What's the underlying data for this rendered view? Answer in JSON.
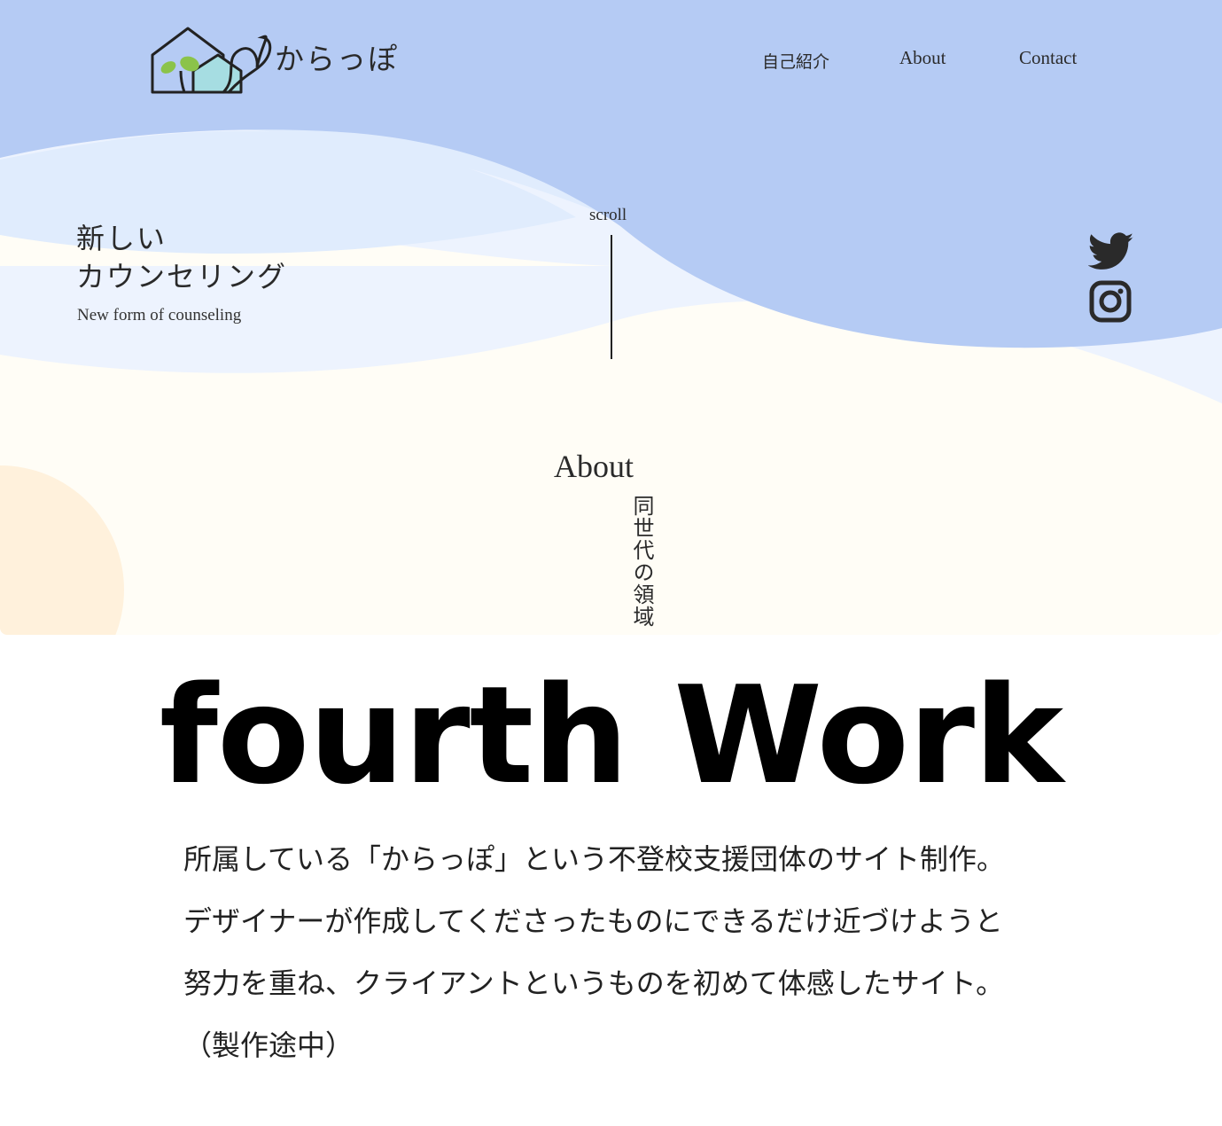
{
  "site": {
    "logo_text": "からっぽ",
    "nav": [
      {
        "label": "自己紹介"
      },
      {
        "label": "About"
      },
      {
        "label": "Contact"
      }
    ],
    "hero": {
      "title_line1": "新しい",
      "title_line2": "カウンセリング",
      "subtitle": "New form of counseling"
    },
    "scroll_label": "scroll",
    "social": [
      "twitter-icon",
      "instagram-icon"
    ],
    "about": {
      "heading": "About",
      "vertical_text": "同世代の領域"
    },
    "colors": {
      "header_blue": "#b5cbf4",
      "light_blue": "#e0ecfd",
      "pale_blue": "#edf3fe",
      "cream": "#fffdf6",
      "peach": "#fff1dc"
    }
  },
  "caption": {
    "title": "fourth Work",
    "lines": [
      "所属している「からっぽ」という不登校支援団体のサイト制作。",
      "デザイナーが作成してくださったものにできるだけ近づけようと",
      "努力を重ね、クライアントというものを初めて体感したサイト。",
      "（製作途中）"
    ]
  }
}
